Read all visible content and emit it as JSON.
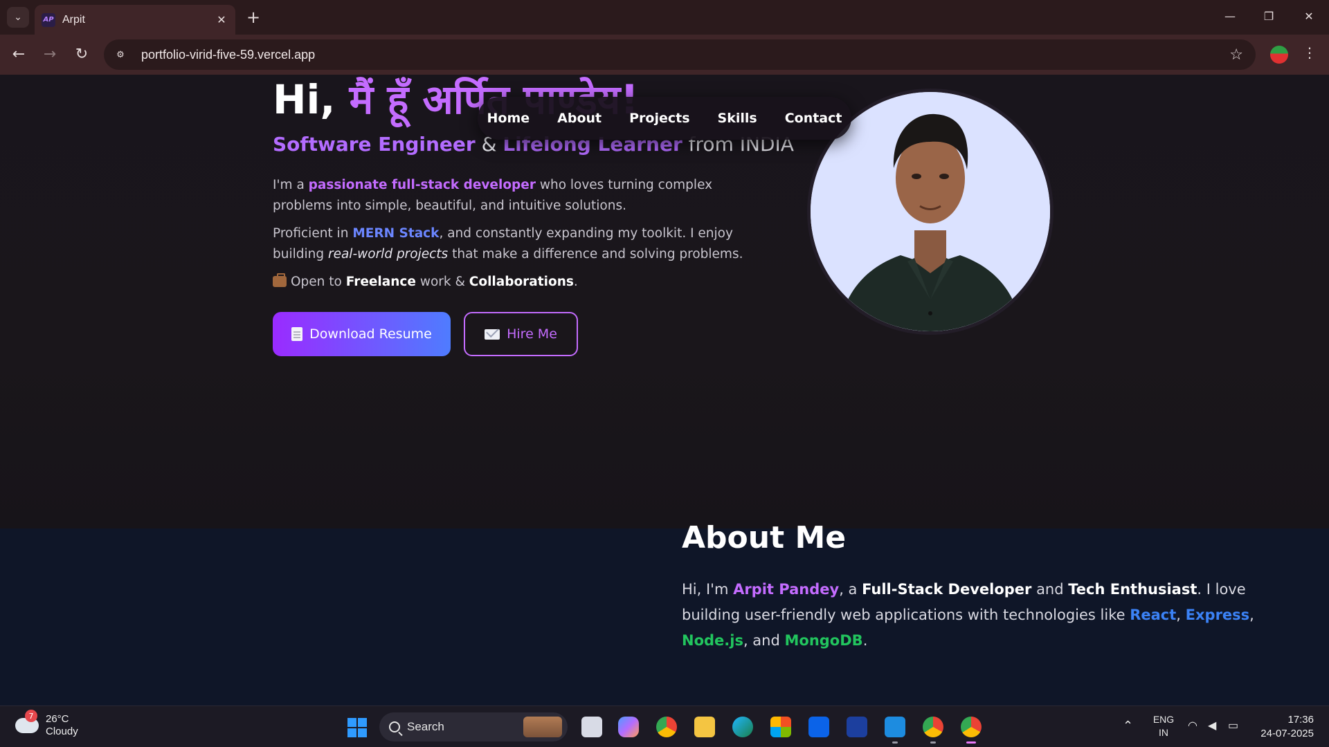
{
  "browser": {
    "tab_title": "Arpit",
    "tab_favicon": "AP",
    "url": "portfolio-virid-five-59.vercel.app"
  },
  "hero": {
    "greeting": "Hi, ",
    "name_hindi": "मैं हूँ अर्पित पाण्डेय!",
    "subtitle": {
      "role1": "Software Engineer",
      "amp": " & ",
      "role2": "Lifelong Learner",
      "from": " from INDIA"
    },
    "para1": {
      "a": "I'm a ",
      "b": "passionate full-stack developer",
      "c": " who loves turning complex problems into simple, beautiful, and intuitive solutions."
    },
    "para2": {
      "a": "Proficient in ",
      "b": "MERN Stack",
      "c": ", and constantly expanding my toolkit. I enjoy building ",
      "d": "real-world projects",
      "e": " that make a difference and solving problems."
    },
    "para3": {
      "a": "Open to ",
      "b": "Freelance",
      "c": " work & ",
      "d": "Collaborations",
      "e": "."
    },
    "buttons": {
      "resume": "Download Resume",
      "hire": "Hire Me"
    }
  },
  "navbar": {
    "items": [
      "Home",
      "About",
      "Projects",
      "Skills",
      "Contact"
    ]
  },
  "about": {
    "title": "About Me",
    "p": {
      "a": "Hi, I'm ",
      "b": "Arpit Pandey",
      "c": ", a ",
      "d": "Full-Stack Developer",
      "e": " and ",
      "f": "Tech Enthusiast",
      "g": ". I love building user-friendly web applications with technologies like ",
      "h": "React",
      "i": ", ",
      "j": "Express",
      "k": ", ",
      "l": "Node.js",
      "m": ", and ",
      "n": "MongoDB",
      "o": "."
    }
  },
  "taskbar": {
    "weather_temp": "26°C",
    "weather_desc": "Cloudy",
    "weather_badge": "7",
    "search_label": "Search",
    "lang": "ENG",
    "region": "IN",
    "time": "17:36",
    "date": "24-07-2025"
  },
  "colors": {
    "accent_purple": "#c46cff",
    "accent_blue": "#6b86ff",
    "hero_bg": "#19151c",
    "about_bg": "#0f1628"
  }
}
